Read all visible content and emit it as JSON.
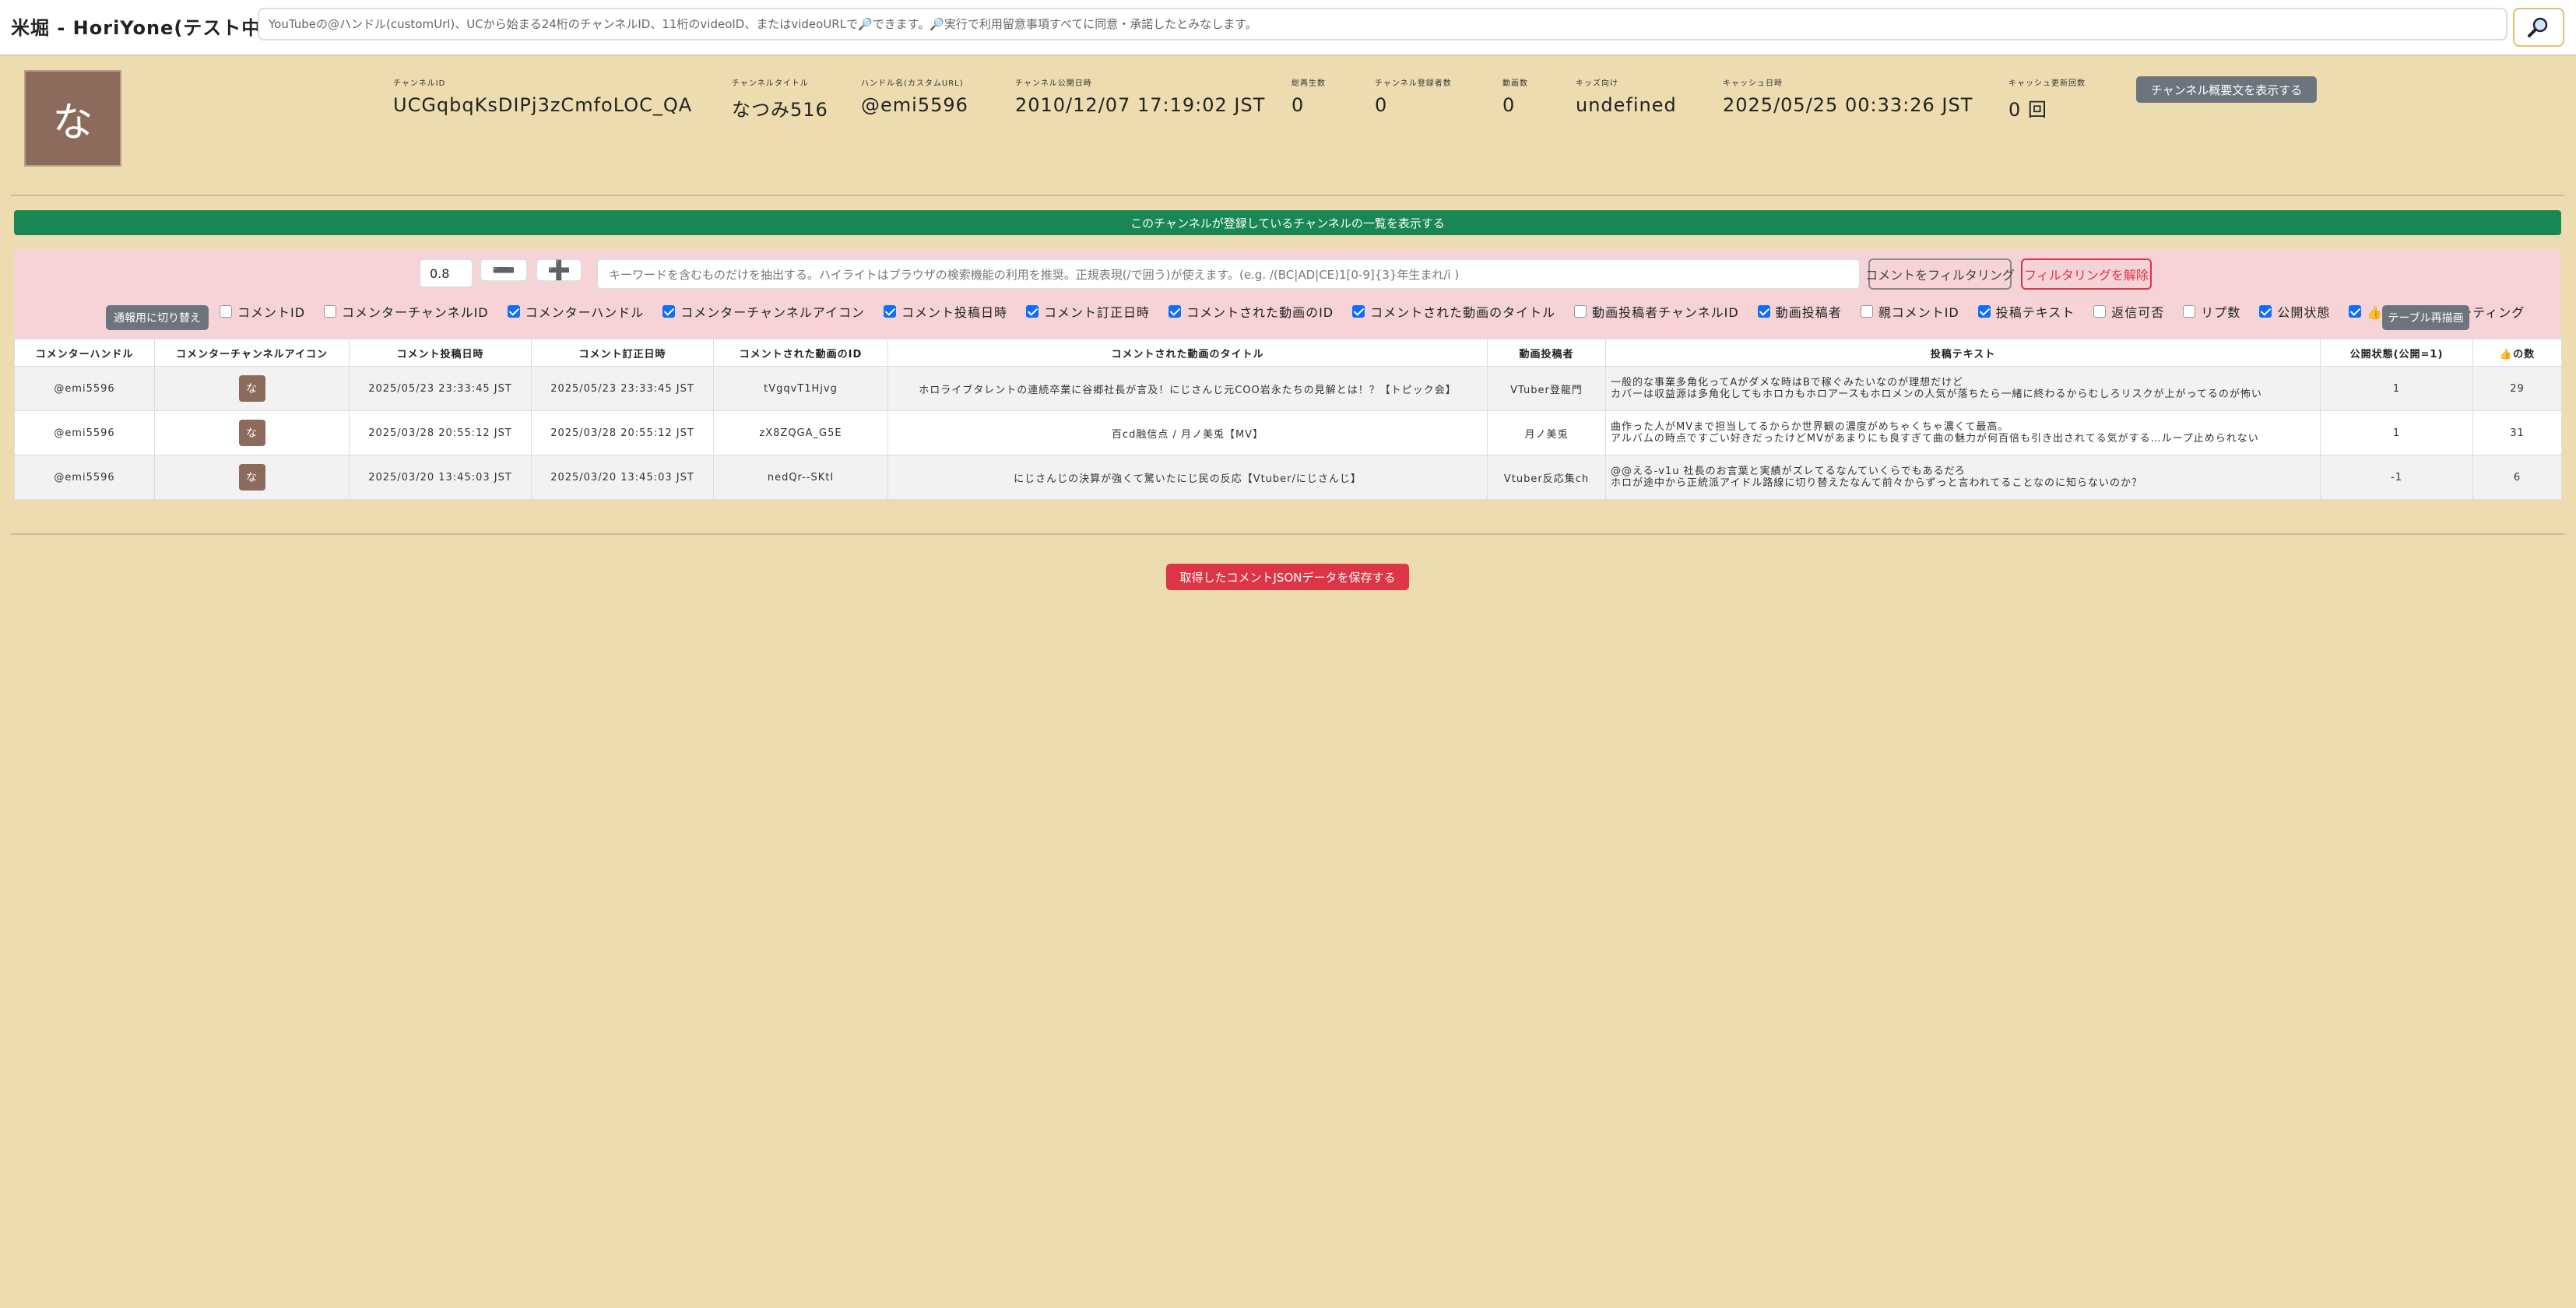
{
  "app": {
    "title": "米堀 - HoriYone(テスト中)"
  },
  "search": {
    "placeholder": "YouTubeの@ハンドル(customUrl)、UCから始まる24桁のチャンネルID、11桁のvideoID、またはvideoURLで🔎できます。🔎実行で利用留意事項すべてに同意・承諾したとみなします。",
    "button_icon": "magnifier-icon"
  },
  "channel": {
    "avatar_char": "な",
    "stats": [
      {
        "label": "チャンネルID",
        "value": "UCGqbqKsDIPj3zCmfoLOC_QA"
      },
      {
        "label": "チャンネルタイトル",
        "value": "なつみ516"
      },
      {
        "label": "ハンドル名(カスタムURL)",
        "value": "@emi5596"
      },
      {
        "label": "チャンネル公開日時",
        "value": "2010/12/07 17:19:02 JST"
      },
      {
        "label": "総再生数",
        "value": "0"
      },
      {
        "label": "チャンネル登録者数",
        "value": "0"
      },
      {
        "label": "動画数",
        "value": "0"
      },
      {
        "label": "キッズ向け",
        "value": "undefined"
      },
      {
        "label": "キャッシュ日時",
        "value": "2025/05/25 00:33:26 JST"
      },
      {
        "label": "キャッシュ更新回数",
        "value": "0 回"
      }
    ],
    "overview_button": "チャンネル概要文を表示する"
  },
  "subscriptions_bar": "このチャンネルが登録しているチャンネルの一覧を表示する",
  "filter": {
    "zoom_value": "0.8",
    "minus_label": "➖",
    "plus_label": "➕",
    "keyword_placeholder": "キーワードを含むものだけを抽出する。ハイライトはブラウザの検索機能の利用を推奨。正規表現(/で囲う)が使えます。(e.g. /(BC|AD|CE)1[0-9]{3}年生まれ/i )",
    "filter_button": "コメントをフィルタリング",
    "clear_button": "フィルタリングを解除",
    "mode_button": "通報用に切り替え",
    "redraw_button": "テーブル再描画",
    "columns": [
      {
        "label": "コメントID",
        "checked": false
      },
      {
        "label": "コメンターチャンネルID",
        "checked": false
      },
      {
        "label": "コメンターハンドル",
        "checked": true
      },
      {
        "label": "コメンターチャンネルアイコン",
        "checked": true
      },
      {
        "label": "コメント投稿日時",
        "checked": true
      },
      {
        "label": "コメント訂正日時",
        "checked": true
      },
      {
        "label": "コメントされた動画のID",
        "checked": true
      },
      {
        "label": "コメントされた動画のタイトル",
        "checked": true
      },
      {
        "label": "動画投稿者チャンネルID",
        "checked": false
      },
      {
        "label": "動画投稿者",
        "checked": true
      },
      {
        "label": "親コメントID",
        "checked": false
      },
      {
        "label": "投稿テキスト",
        "checked": true
      },
      {
        "label": "返信可否",
        "checked": false
      },
      {
        "label": "リプ数",
        "checked": false
      },
      {
        "label": "公開状態",
        "checked": true
      },
      {
        "label": "👍の数",
        "checked": true
      },
      {
        "label": "レーティング",
        "checked": false
      }
    ]
  },
  "table": {
    "headers": [
      "コメンターハンドル",
      "コメンターチャンネルアイコン",
      "コメント投稿日時",
      "コメント訂正日時",
      "コメントされた動画のID",
      "コメントされた動画のタイトル",
      "動画投稿者",
      "投稿テキスト",
      "公開状態(公開=1)",
      "👍の数"
    ],
    "rows": [
      {
        "handle": "@emi5596",
        "icon": "な",
        "posted": "2025/05/23 23:33:45 JST",
        "edited": "2025/05/23 23:33:45 JST",
        "video_id": "tVgqvT1Hjvg",
        "video_title": "ホロライブタレントの連続卒業に谷郷社長が言及！にじさんじ元COO岩永たちの見解とは！？【トピック会】",
        "uploader": "VTuber登龍門",
        "text": "一般的な事業多角化ってAがダメな時はBで稼ぐみたいなのが理想だけど\nカバーは収益源は多角化してもホロカもホロアースもホロメンの人気が落ちたら一緒に終わるからむしろリスクが上がってるのが怖い",
        "status": "1",
        "likes": "29"
      },
      {
        "handle": "@emi5596",
        "icon": "な",
        "posted": "2025/03/28 20:55:12 JST",
        "edited": "2025/03/28 20:55:12 JST",
        "video_id": "zX8ZQGA_G5E",
        "video_title": "百cd融信点 / 月ノ美兎【MV】",
        "uploader": "月ノ美兎",
        "text": "曲作った人がMVまで担当してるからか世界観の濃度がめちゃくちゃ濃くて最高。\nアルバムの時点ですごい好きだったけどMVがあまりにも良すぎて曲の魅力が何百倍も引き出されてる気がする…ループ止められない",
        "status": "1",
        "likes": "31"
      },
      {
        "handle": "@emi5596",
        "icon": "な",
        "posted": "2025/03/20 13:45:03 JST",
        "edited": "2025/03/20 13:45:03 JST",
        "video_id": "nedQr--SKtI",
        "video_title": "にじさんじの決算が強くて驚いたにじ民の反応【Vtuber/にじさんじ】",
        "uploader": "Vtuber反応集ch",
        "text": "@@える-v1u 社長のお言葉と実績がズレてるなんていくらでもあるだろ\nホロが途中から正統派アイドル路線に切り替えたなんて前々からずっと言われてることなのに知らないのか？",
        "status": "-1",
        "likes": "6"
      }
    ]
  },
  "save_button": "取得したコメントJSONデータを保存する"
}
